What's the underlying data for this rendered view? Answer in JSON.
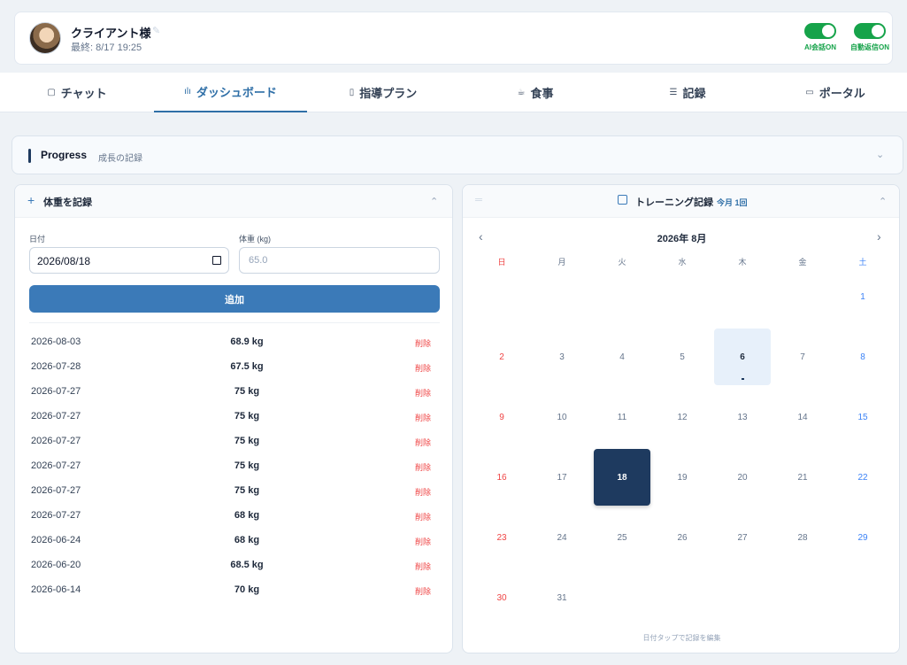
{
  "header": {
    "client_name": "クライアント様",
    "last_seen": "最終: 8/17 19:25",
    "toggles": [
      {
        "label": "AI会話ON",
        "on": true
      },
      {
        "label": "自動返信ON",
        "on": true
      }
    ]
  },
  "tabs": [
    {
      "label": "チャット",
      "icon": "chat-icon",
      "glyph": "▢"
    },
    {
      "label": "ダッシュボード",
      "icon": "chart-icon",
      "glyph": "ılı",
      "active": true
    },
    {
      "label": "指導プラン",
      "icon": "clipboard-icon",
      "glyph": "▯"
    },
    {
      "label": "食事",
      "icon": "cup-icon",
      "glyph": "☕"
    },
    {
      "label": "記録",
      "icon": "list-icon",
      "glyph": "☰"
    },
    {
      "label": "ポータル",
      "icon": "monitor-icon",
      "glyph": "▭"
    }
  ],
  "progress": {
    "title": "Progress",
    "subtitle": "成長の記録"
  },
  "weight_panel": {
    "title": "体重を記録",
    "date_label": "日付",
    "date_value": "2026/08/18",
    "weight_label": "体重 (kg)",
    "weight_placeholder": "65.0",
    "add_label": "追加",
    "delete_label": "削除",
    "records": [
      {
        "date": "2026-08-03",
        "weight": "68.9 kg"
      },
      {
        "date": "2026-07-28",
        "weight": "67.5 kg"
      },
      {
        "date": "2026-07-27",
        "weight": "75 kg"
      },
      {
        "date": "2026-07-27",
        "weight": "75 kg"
      },
      {
        "date": "2026-07-27",
        "weight": "75 kg"
      },
      {
        "date": "2026-07-27",
        "weight": "75 kg"
      },
      {
        "date": "2026-07-27",
        "weight": "75 kg"
      },
      {
        "date": "2026-07-27",
        "weight": "68 kg"
      },
      {
        "date": "2026-06-24",
        "weight": "68 kg"
      },
      {
        "date": "2026-06-20",
        "weight": "68.5 kg"
      },
      {
        "date": "2026-06-14",
        "weight": "70 kg"
      }
    ]
  },
  "training_panel": {
    "title": "トレーニング記録",
    "badge": "今月 1回",
    "month": "2026年 8月",
    "weekdays": [
      "日",
      "月",
      "火",
      "水",
      "木",
      "金",
      "土"
    ],
    "first_weekday": 6,
    "days_in_month": 31,
    "today": 18,
    "marked_days": [
      6
    ],
    "hint": "日付タップで記録を編集"
  }
}
